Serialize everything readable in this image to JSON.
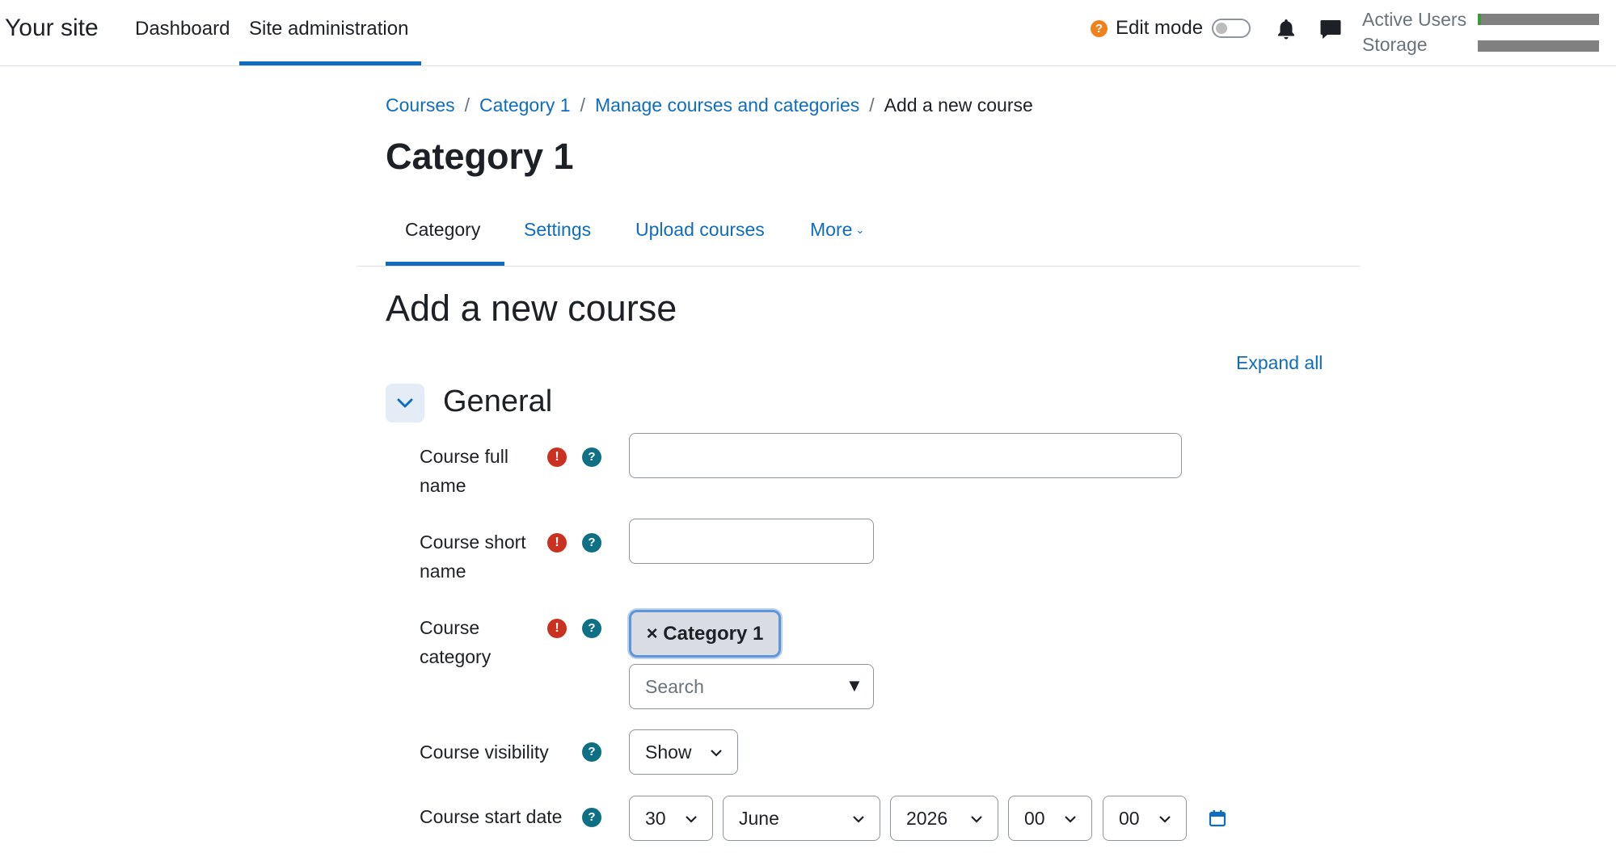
{
  "navbar": {
    "brand": "Your site",
    "links": [
      "Dashboard",
      "Site administration"
    ],
    "edit_mode_label": "Edit mode",
    "usage": {
      "active_users_label": "Active Users",
      "storage_label": "Storage"
    },
    "icons": {
      "help": "question-icon",
      "notifications": "bell-icon",
      "messages": "chat-icon"
    }
  },
  "breadcrumb": [
    "Courses",
    "Category 1",
    "Manage courses and categories",
    "Add a new course"
  ],
  "page_title": "Category 1",
  "tabs": [
    "Category",
    "Settings",
    "Upload courses",
    "More"
  ],
  "section_title": "Add a new course",
  "expand_all": "Expand all",
  "general": {
    "title": "General",
    "fields": {
      "full_name": {
        "label_line1": "Course full",
        "label_line2": "name",
        "value": ""
      },
      "short_name": {
        "label_line1": "Course short",
        "label_line2": "name",
        "value": ""
      },
      "category": {
        "label_line1": "Course",
        "label_line2": "category",
        "selected": "× Category 1",
        "search_placeholder": "Search",
        "dropdown_glyph": "▼"
      },
      "visibility": {
        "label": "Course visibility",
        "value": "Show"
      },
      "start_date": {
        "label": "Course start date",
        "day": "30",
        "month": "June",
        "year": "2026",
        "hour": "00",
        "minute": "00"
      }
    }
  },
  "colors": {
    "brand": "#0f6cbf",
    "required": "#ca3120",
    "help": "#0f7085",
    "edit_help": "#f0811f"
  }
}
